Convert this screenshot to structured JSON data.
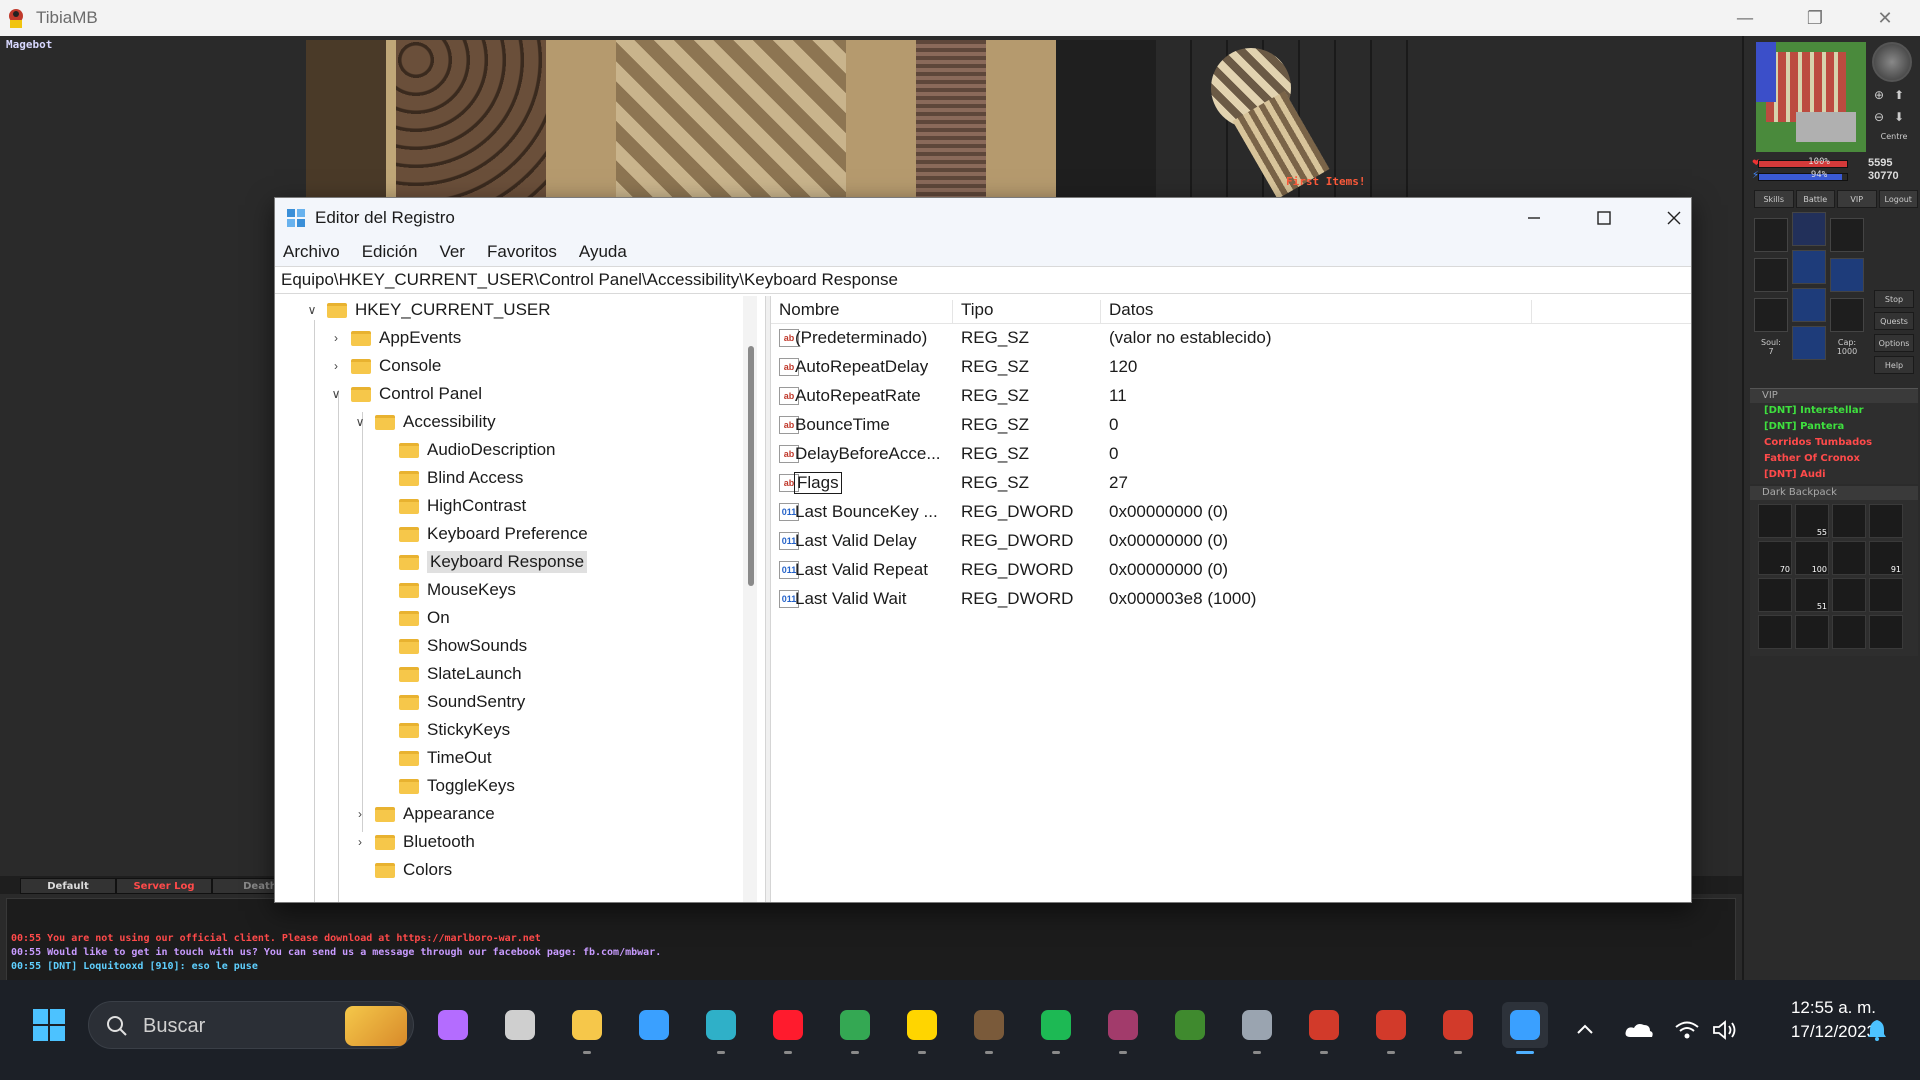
{
  "tibia": {
    "window_title": "TibiaMB",
    "overlay_label": "Magebot",
    "game_message": "First Items!",
    "stats": {
      "health_pct": "100%",
      "mana_pct": "94%",
      "health_value": "5595",
      "mana_value": "30770"
    },
    "panel_buttons": [
      "Skills",
      "Battle",
      "VIP",
      "Logout"
    ],
    "side_buttons": [
      "Stop",
      "Quests",
      "Options",
      "Help"
    ],
    "soul_label": "Soul:",
    "soul_value": "7",
    "cap_label": "Cap:",
    "cap_value": "1000",
    "map_centre": "Centre",
    "vip": {
      "title": "VIP",
      "items": [
        {
          "name": "[DNT] Interstellar",
          "color": "#3ee03e"
        },
        {
          "name": "[DNT] Pantera",
          "color": "#3ee03e"
        },
        {
          "name": "Corridos Tumbados",
          "color": "#ff4a4a"
        },
        {
          "name": "Father Of Cronox",
          "color": "#ff4a4a"
        },
        {
          "name": "[DNT] Audi",
          "color": "#ff4a4a"
        }
      ]
    },
    "backpack": {
      "title": "Dark Backpack",
      "slots": [
        "",
        "55",
        "",
        "",
        "70",
        "100",
        "",
        "91",
        "",
        "51",
        "",
        "",
        "",
        "",
        "",
        ""
      ]
    },
    "chat_tabs": [
      {
        "label": "Default",
        "color": "#dcdcdc"
      },
      {
        "label": "Server Log",
        "color": "#ff4a4a"
      },
      {
        "label": "Death",
        "color": "#888888"
      }
    ],
    "chat_lines": [
      {
        "text": "00:55 You are not using our official client. Please download at https://marlboro-war.net",
        "color": "#ff4a4a"
      },
      {
        "text": "00:55 Would like to get in touch with us? You can send us a message through our facebook page: fb.com/mbwar.",
        "color": "#c89bff"
      },
      {
        "text": "00:55 [DNT] Loquitooxd [910]: eso le puse",
        "color": "#5fd0ff"
      }
    ]
  },
  "regedit": {
    "title": "Editor del Registro",
    "menu": [
      "Archivo",
      "Edición",
      "Ver",
      "Favoritos",
      "Ayuda"
    ],
    "address": "Equipo\\HKEY_CURRENT_USER\\Control Panel\\Accessibility\\Keyboard Response",
    "tree": [
      {
        "label": "HKEY_CURRENT_USER",
        "depth": 0,
        "chev": "expanded"
      },
      {
        "label": "AppEvents",
        "depth": 1,
        "chev": "collapsed"
      },
      {
        "label": "Console",
        "depth": 1,
        "chev": "collapsed"
      },
      {
        "label": "Control Panel",
        "depth": 1,
        "chev": "expanded"
      },
      {
        "label": "Accessibility",
        "depth": 2,
        "chev": "expanded"
      },
      {
        "label": "AudioDescription",
        "depth": 3,
        "chev": "none"
      },
      {
        "label": "Blind Access",
        "depth": 3,
        "chev": "none"
      },
      {
        "label": "HighContrast",
        "depth": 3,
        "chev": "none"
      },
      {
        "label": "Keyboard Preference",
        "depth": 3,
        "chev": "none"
      },
      {
        "label": "Keyboard Response",
        "depth": 3,
        "chev": "none",
        "selected": true
      },
      {
        "label": "MouseKeys",
        "depth": 3,
        "chev": "none"
      },
      {
        "label": "On",
        "depth": 3,
        "chev": "none"
      },
      {
        "label": "ShowSounds",
        "depth": 3,
        "chev": "none"
      },
      {
        "label": "SlateLaunch",
        "depth": 3,
        "chev": "none"
      },
      {
        "label": "SoundSentry",
        "depth": 3,
        "chev": "none"
      },
      {
        "label": "StickyKeys",
        "depth": 3,
        "chev": "none"
      },
      {
        "label": "TimeOut",
        "depth": 3,
        "chev": "none"
      },
      {
        "label": "ToggleKeys",
        "depth": 3,
        "chev": "none"
      },
      {
        "label": "Appearance",
        "depth": 2,
        "chev": "collapsed"
      },
      {
        "label": "Bluetooth",
        "depth": 2,
        "chev": "collapsed"
      },
      {
        "label": "Colors",
        "depth": 2,
        "chev": "none"
      }
    ],
    "columns": [
      "Nombre",
      "Tipo",
      "Datos"
    ],
    "values": [
      {
        "name": "(Predeterminado)",
        "type": "REG_SZ",
        "data": "(valor no establecido)",
        "kind": "sz"
      },
      {
        "name": "AutoRepeatDelay",
        "type": "REG_SZ",
        "data": "120",
        "kind": "sz"
      },
      {
        "name": "AutoRepeatRate",
        "type": "REG_SZ",
        "data": "11",
        "kind": "sz"
      },
      {
        "name": "BounceTime",
        "type": "REG_SZ",
        "data": "0",
        "kind": "sz"
      },
      {
        "name": "DelayBeforeAcce...",
        "type": "REG_SZ",
        "data": "0",
        "kind": "sz"
      },
      {
        "name": "Flags",
        "type": "REG_SZ",
        "data": "27",
        "kind": "sz",
        "focused": true
      },
      {
        "name": "Last BounceKey ...",
        "type": "REG_DWORD",
        "data": "0x00000000 (0)",
        "kind": "dw"
      },
      {
        "name": "Last Valid Delay",
        "type": "REG_DWORD",
        "data": "0x00000000 (0)",
        "kind": "dw"
      },
      {
        "name": "Last Valid Repeat",
        "type": "REG_DWORD",
        "data": "0x00000000 (0)",
        "kind": "dw"
      },
      {
        "name": "Last Valid Wait",
        "type": "REG_DWORD",
        "data": "0x000003e8 (1000)",
        "kind": "dw"
      }
    ]
  },
  "taskbar": {
    "search_placeholder": "Buscar",
    "time": "12:55 a. m.",
    "date": "17/12/2023",
    "apps": [
      {
        "name": "copilot-icon",
        "color": "#b46cff"
      },
      {
        "name": "task-view-icon",
        "color": "#cfcfcf"
      },
      {
        "name": "file-explorer-icon",
        "color": "#f6c74a"
      },
      {
        "name": "store-icon",
        "color": "#3aa0ff"
      },
      {
        "name": "edge-icon",
        "color": "#2fb0c8"
      },
      {
        "name": "opera-icon",
        "color": "#ff1b2d"
      },
      {
        "name": "chrome-icon",
        "color": "#34a853"
      },
      {
        "name": "sticky-notes-icon",
        "color": "#ffd500"
      },
      {
        "name": "character-app-icon",
        "color": "#7a5a3a"
      },
      {
        "name": "spotify-icon",
        "color": "#1db954"
      },
      {
        "name": "winrar-icon",
        "color": "#a23b6b"
      },
      {
        "name": "game-app-icon",
        "color": "#3f8a2e"
      },
      {
        "name": "settings-icon",
        "color": "#9aa4b0"
      },
      {
        "name": "tibia-icon-1",
        "color": "#d23a2a"
      },
      {
        "name": "tibia-icon-2",
        "color": "#d23a2a"
      },
      {
        "name": "tibia-icon-3",
        "color": "#d23a2a"
      },
      {
        "name": "regedit-icon",
        "color": "#3aa0ff"
      }
    ]
  }
}
